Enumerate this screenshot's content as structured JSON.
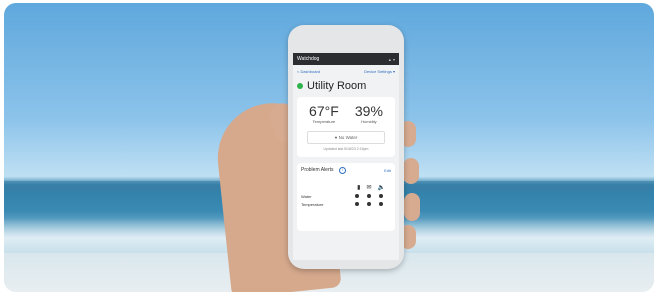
{
  "app": {
    "brand": "Watchdog",
    "user_menu": "▲ ▾"
  },
  "nav": {
    "back": "< Dashboard",
    "settings": "Device Settings ▾"
  },
  "device": {
    "name": "Utility Room",
    "status_color": "#2fb14c"
  },
  "readings": {
    "temperature_value": "67°F",
    "temperature_label": "Temperature",
    "humidity_value": "39%",
    "humidity_label": "Humidity"
  },
  "water": {
    "label": "No Water",
    "updated": "Updated last 5/18/23 2:15pm"
  },
  "alerts": {
    "title": "Problem Alerts",
    "edit": "Edit",
    "rows": [
      {
        "label": "Water"
      },
      {
        "label": "Temperature"
      }
    ]
  }
}
